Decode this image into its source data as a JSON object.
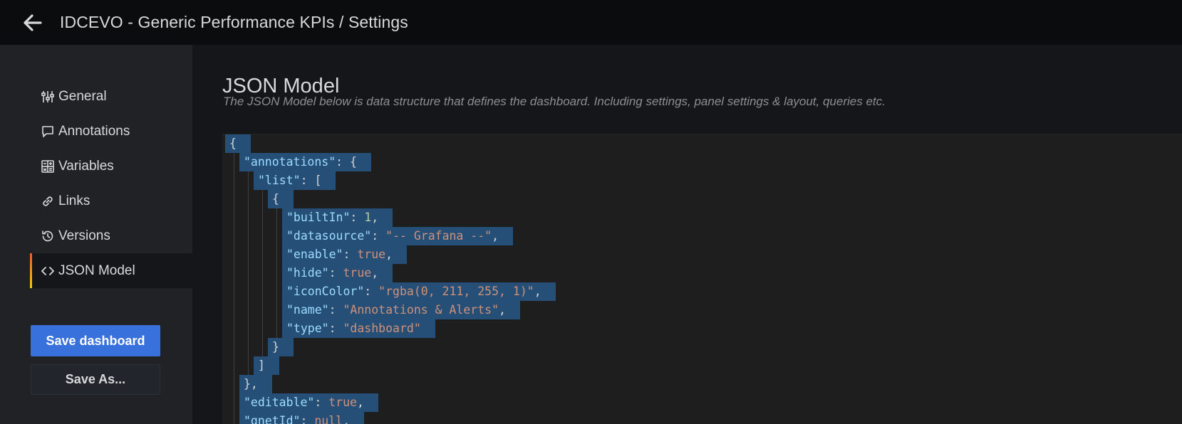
{
  "topbar": {
    "back_icon": "arrow-left-icon",
    "title": "IDCEVO - Generic Performance KPIs / Settings"
  },
  "sidebar": {
    "items": [
      {
        "label": "General",
        "icon": "sliders-icon",
        "active": false
      },
      {
        "label": "Annotations",
        "icon": "comment-icon",
        "active": false
      },
      {
        "label": "Variables",
        "icon": "calculator-icon",
        "active": false
      },
      {
        "label": "Links",
        "icon": "link-icon",
        "active": false
      },
      {
        "label": "Versions",
        "icon": "history-icon",
        "active": false
      },
      {
        "label": "JSON Model",
        "icon": "code-icon",
        "active": true
      }
    ],
    "save_button": "Save dashboard",
    "save_as_button": "Save As..."
  },
  "main": {
    "title": "JSON Model",
    "description": "The JSON Model below is data structure that defines the dashboard. Including settings, panel settings & layout, queries etc."
  },
  "editor": {
    "lines": [
      {
        "indent": 0,
        "tokens": [
          {
            "t": "p",
            "v": "{"
          }
        ]
      },
      {
        "indent": 1,
        "tokens": [
          {
            "t": "k",
            "v": "\"annotations\""
          },
          {
            "t": "p",
            "v": ": {"
          }
        ]
      },
      {
        "indent": 2,
        "tokens": [
          {
            "t": "k",
            "v": "\"list\""
          },
          {
            "t": "p",
            "v": ": ["
          }
        ]
      },
      {
        "indent": 3,
        "tokens": [
          {
            "t": "p",
            "v": "{"
          }
        ]
      },
      {
        "indent": 4,
        "tokens": [
          {
            "t": "k",
            "v": "\"builtIn\""
          },
          {
            "t": "p",
            "v": ": "
          },
          {
            "t": "n",
            "v": "1"
          },
          {
            "t": "p",
            "v": ","
          }
        ]
      },
      {
        "indent": 4,
        "tokens": [
          {
            "t": "k",
            "v": "\"datasource\""
          },
          {
            "t": "p",
            "v": ": "
          },
          {
            "t": "s",
            "v": "\"-- Grafana --\""
          },
          {
            "t": "p",
            "v": ","
          }
        ]
      },
      {
        "indent": 4,
        "tokens": [
          {
            "t": "k",
            "v": "\"enable\""
          },
          {
            "t": "p",
            "v": ": "
          },
          {
            "t": "b",
            "v": "true"
          },
          {
            "t": "p",
            "v": ","
          }
        ]
      },
      {
        "indent": 4,
        "tokens": [
          {
            "t": "k",
            "v": "\"hide\""
          },
          {
            "t": "p",
            "v": ": "
          },
          {
            "t": "b",
            "v": "true"
          },
          {
            "t": "p",
            "v": ","
          }
        ]
      },
      {
        "indent": 4,
        "tokens": [
          {
            "t": "k",
            "v": "\"iconColor\""
          },
          {
            "t": "p",
            "v": ": "
          },
          {
            "t": "s",
            "v": "\"rgba(0, 211, 255, 1)\""
          },
          {
            "t": "p",
            "v": ","
          }
        ]
      },
      {
        "indent": 4,
        "tokens": [
          {
            "t": "k",
            "v": "\"name\""
          },
          {
            "t": "p",
            "v": ": "
          },
          {
            "t": "s",
            "v": "\"Annotations & Alerts\""
          },
          {
            "t": "p",
            "v": ","
          }
        ]
      },
      {
        "indent": 4,
        "tokens": [
          {
            "t": "k",
            "v": "\"type\""
          },
          {
            "t": "p",
            "v": ": "
          },
          {
            "t": "s",
            "v": "\"dashboard\""
          }
        ]
      },
      {
        "indent": 3,
        "tokens": [
          {
            "t": "p",
            "v": "}"
          }
        ]
      },
      {
        "indent": 2,
        "tokens": [
          {
            "t": "p",
            "v": "]"
          }
        ]
      },
      {
        "indent": 1,
        "tokens": [
          {
            "t": "p",
            "v": "},"
          }
        ]
      },
      {
        "indent": 1,
        "tokens": [
          {
            "t": "k",
            "v": "\"editable\""
          },
          {
            "t": "p",
            "v": ": "
          },
          {
            "t": "b",
            "v": "true"
          },
          {
            "t": "p",
            "v": ","
          }
        ]
      },
      {
        "indent": 1,
        "tokens": [
          {
            "t": "k",
            "v": "\"gnetId\""
          },
          {
            "t": "p",
            "v": ": "
          },
          {
            "t": "b",
            "v": "null"
          },
          {
            "t": "p",
            "v": ","
          }
        ]
      }
    ]
  },
  "colors": {
    "accent_blue": "#3871dc",
    "selection": "#264f78",
    "active_bar_top": "#f05a28",
    "active_bar_bottom": "#fbca0a"
  }
}
